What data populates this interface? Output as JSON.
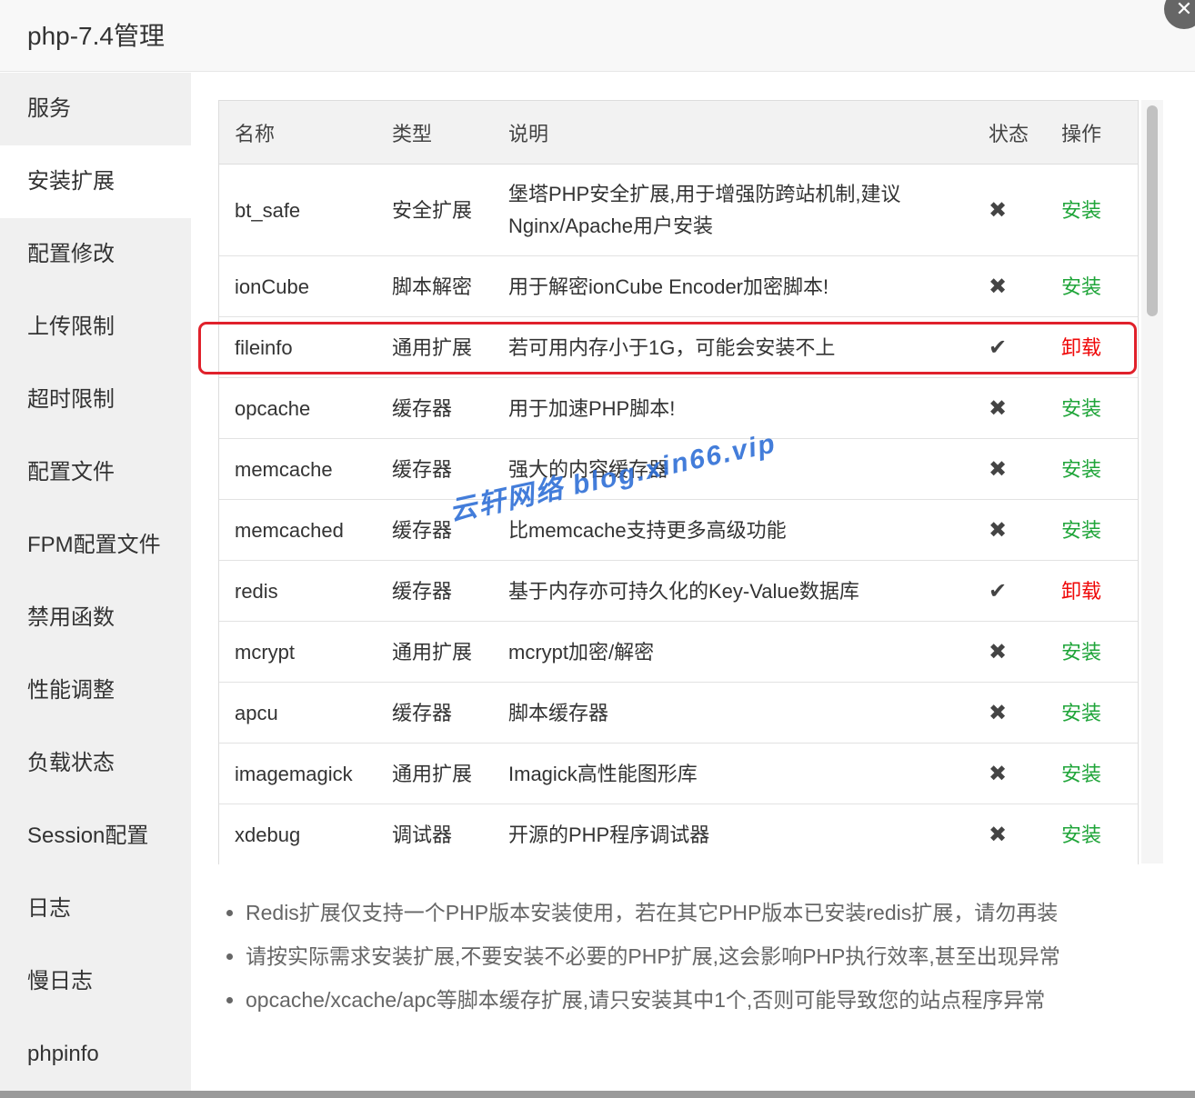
{
  "dialog": {
    "title": "php-7.4管理",
    "close_glyph": "✕"
  },
  "sidebar": {
    "items": [
      {
        "label": "服务",
        "active": false
      },
      {
        "label": "安装扩展",
        "active": true
      },
      {
        "label": "配置修改",
        "active": false
      },
      {
        "label": "上传限制",
        "active": false
      },
      {
        "label": "超时限制",
        "active": false
      },
      {
        "label": "配置文件",
        "active": false
      },
      {
        "label": "FPM配置文件",
        "active": false
      },
      {
        "label": "禁用函数",
        "active": false
      },
      {
        "label": "性能调整",
        "active": false
      },
      {
        "label": "负载状态",
        "active": false
      },
      {
        "label": "Session配置",
        "active": false
      },
      {
        "label": "日志",
        "active": false
      },
      {
        "label": "慢日志",
        "active": false
      },
      {
        "label": "phpinfo",
        "active": false
      }
    ]
  },
  "table": {
    "headers": {
      "name": "名称",
      "type": "类型",
      "desc": "说明",
      "status": "状态",
      "action": "操作"
    },
    "rows": [
      {
        "name": "bt_safe",
        "type": "安全扩展",
        "desc": "堡塔PHP安全扩展,用于增强防跨站机制,建议Nginx/Apache用户安装",
        "status_glyph": "✖",
        "installed": false,
        "action": "安装"
      },
      {
        "name": "ionCube",
        "type": "脚本解密",
        "desc": "用于解密ionCube Encoder加密脚本!",
        "status_glyph": "✖",
        "installed": false,
        "action": "安装"
      },
      {
        "name": "fileinfo",
        "type": "通用扩展",
        "desc": "若可用内存小于1G，可能会安装不上",
        "status_glyph": "✔",
        "installed": true,
        "action": "卸载"
      },
      {
        "name": "opcache",
        "type": "缓存器",
        "desc": "用于加速PHP脚本!",
        "status_glyph": "✖",
        "installed": false,
        "action": "安装"
      },
      {
        "name": "memcache",
        "type": "缓存器",
        "desc": "强大的内容缓存器",
        "status_glyph": "✖",
        "installed": false,
        "action": "安装"
      },
      {
        "name": "memcached",
        "type": "缓存器",
        "desc": "比memcache支持更多高级功能",
        "status_glyph": "✖",
        "installed": false,
        "action": "安装"
      },
      {
        "name": "redis",
        "type": "缓存器",
        "desc": "基于内存亦可持久化的Key-Value数据库",
        "status_glyph": "✔",
        "installed": true,
        "action": "卸载"
      },
      {
        "name": "mcrypt",
        "type": "通用扩展",
        "desc": "mcrypt加密/解密",
        "status_glyph": "✖",
        "installed": false,
        "action": "安装"
      },
      {
        "name": "apcu",
        "type": "缓存器",
        "desc": "脚本缓存器",
        "status_glyph": "✖",
        "installed": false,
        "action": "安装"
      },
      {
        "name": "imagemagick",
        "type": "通用扩展",
        "desc": "Imagick高性能图形库",
        "status_glyph": "✖",
        "installed": false,
        "action": "安装"
      },
      {
        "name": "xdebug",
        "type": "调试器",
        "desc": "开源的PHP程序调试器",
        "status_glyph": "✖",
        "installed": false,
        "action": "安装"
      }
    ]
  },
  "watermark": "云轩网络 blog.xin66.vip",
  "notes": [
    "Redis扩展仅支持一个PHP版本安装使用，若在其它PHP版本已安装redis扩展，请勿再装",
    "请按实际需求安装扩展,不要安装不必要的PHP扩展,这会影响PHP执行效率,甚至出现异常",
    "opcache/xcache/apc等脚本缓存扩展,请只安装其中1个,否则可能导致您的站点程序异常"
  ],
  "colors": {
    "install": "#20a53a",
    "uninstall": "#ef0808",
    "highlight": "#e0212b",
    "watermark": "#2f6fd6"
  }
}
